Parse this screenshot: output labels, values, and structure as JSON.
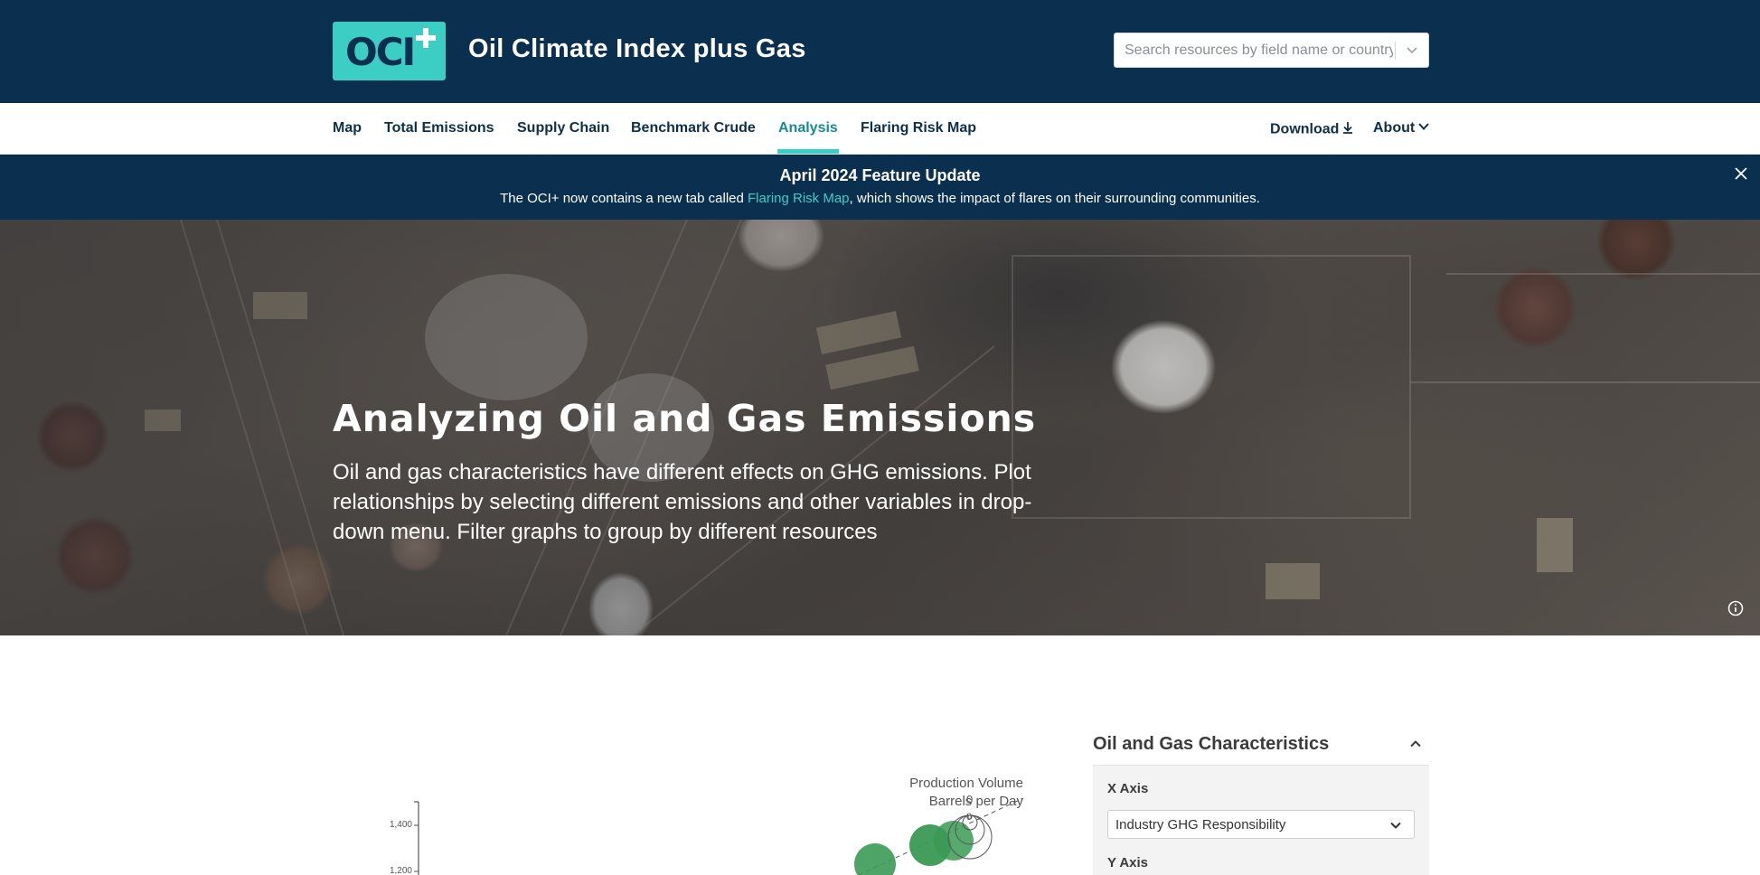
{
  "header": {
    "logo_text": "OCI",
    "site_title": "Oil Climate Index plus Gas",
    "search": {
      "placeholder": "Search resources by field name or country"
    }
  },
  "nav": {
    "items": [
      {
        "label": "Map"
      },
      {
        "label": "Total Emissions"
      },
      {
        "label": "Supply Chain"
      },
      {
        "label": "Benchmark Crude"
      },
      {
        "label": "Analysis",
        "active": true
      },
      {
        "label": "Flaring Risk Map"
      }
    ],
    "download_label": "Download",
    "about_label": "About"
  },
  "banner": {
    "title": "April 2024 Feature Update",
    "body_before": "The OCI+ now contains a new tab called ",
    "link_text": "Flaring Risk Map",
    "body_after": ", which shows the impact of flares on their surrounding communities."
  },
  "hero": {
    "title": "Analyzing Oil and Gas Emissions",
    "description": "Oil and gas characteristics have different effects on GHG emissions. Plot relationships by selecting different emissions and other variables in drop-down menu. Filter graphs to group by different resources"
  },
  "chart_data": {
    "type": "scatter",
    "y_ticks": [
      "1,400",
      "1,200"
    ],
    "legend": {
      "title_line1": "Production Volume",
      "title_line2": "Barrels per Day",
      "size_labels": [
        "0",
        "0"
      ]
    }
  },
  "panel": {
    "title": "Oil and Gas Characteristics",
    "x_axis_label": "X Axis",
    "x_axis_value": "Industry GHG Responsibility",
    "y_axis_label": "Y Axis"
  },
  "colors": {
    "header_bg": "#0a2f4f",
    "accent": "#3ccdc4",
    "active_nav": "#178a96",
    "bubble": "#3a9a55"
  }
}
